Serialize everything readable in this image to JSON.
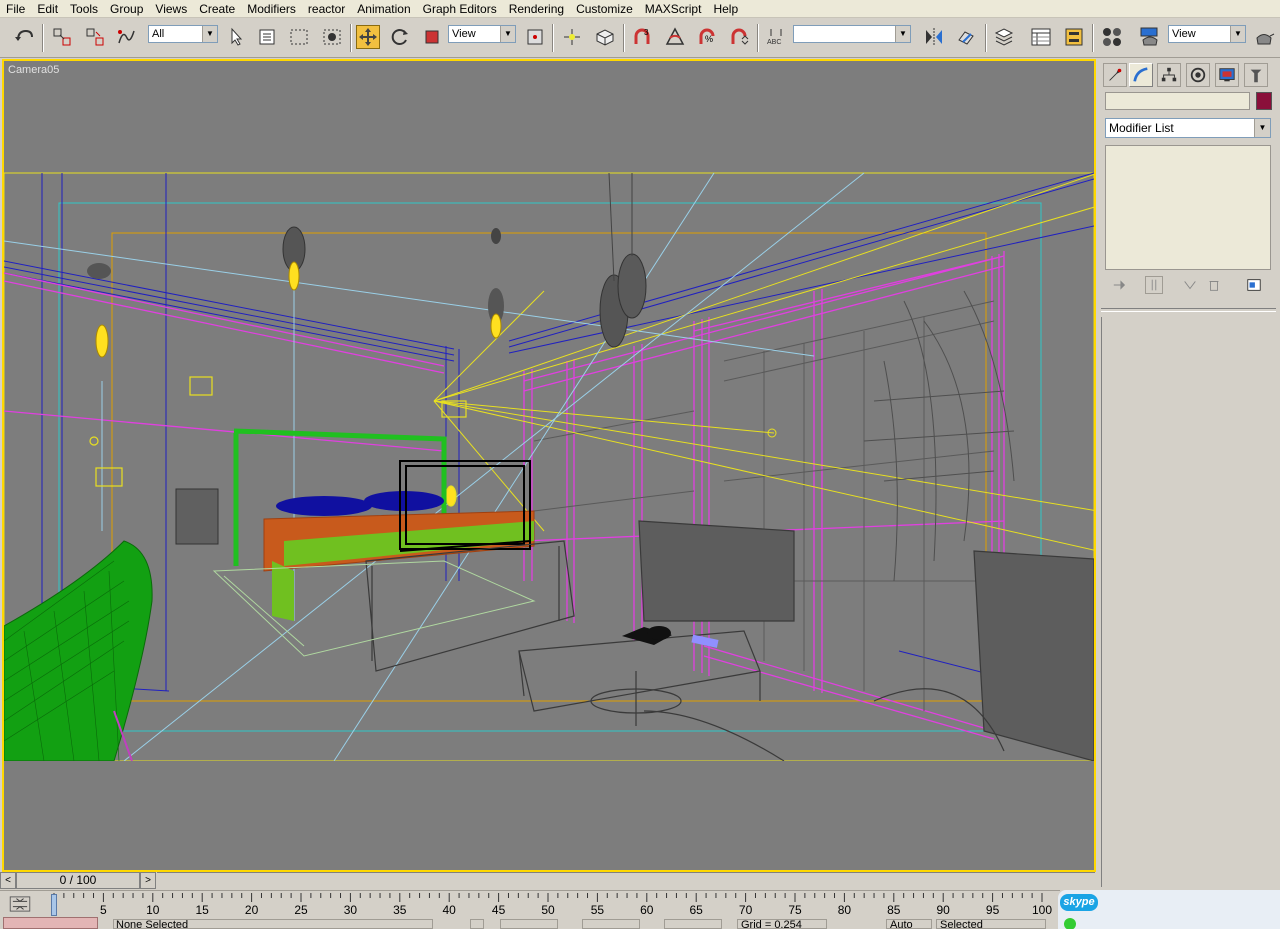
{
  "menu": [
    "File",
    "Edit",
    "Tools",
    "Group",
    "Views",
    "Create",
    "Modifiers",
    "reactor",
    "Animation",
    "Graph Editors",
    "Rendering",
    "Customize",
    "MAXScript",
    "Help"
  ],
  "toolbar": {
    "selection_filter": "All",
    "ref_coord_system": "View",
    "named_selection_set": "",
    "render_viewport": "View"
  },
  "viewport": {
    "label": "Camera05",
    "active_border_color": "#ffd800",
    "background_color": "#7d7d7d"
  },
  "command_panel": {
    "object_name": "",
    "object_color": "#8a0f3a",
    "modifier_list": "Modifier List",
    "tabs": [
      "create-icon",
      "modify-icon",
      "hierarchy-icon",
      "motion-icon",
      "display-icon",
      "utilities-icon"
    ]
  },
  "time_slider": {
    "frame_label": "0 / 100",
    "prev": "<",
    "next": ">"
  },
  "track_bar": {
    "ticks": [
      "0",
      "5",
      "10",
      "15",
      "20",
      "25",
      "30",
      "35",
      "40",
      "45",
      "50",
      "55",
      "60",
      "65",
      "70",
      "75",
      "80",
      "85",
      "90",
      "95",
      "100"
    ],
    "current_frame": 0
  },
  "status": {
    "selection": "None Selected",
    "grid": "Grid = 0.254",
    "auto_key": "Auto Key",
    "set_key_filter": "Selected"
  },
  "skype": {
    "logo": "skype"
  }
}
